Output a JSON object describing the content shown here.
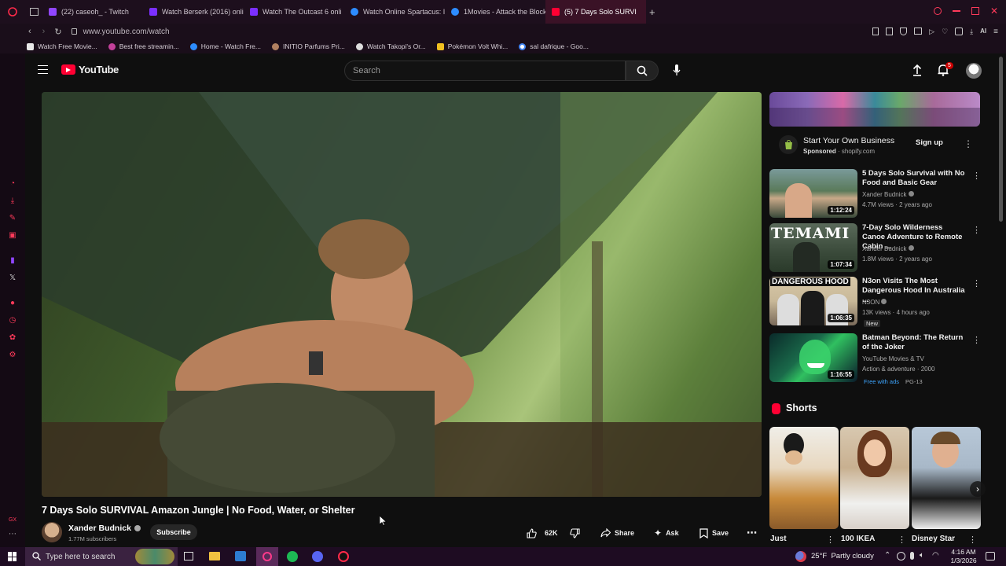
{
  "browser": {
    "tabs": [
      {
        "label": "(22) caseoh_ - Twitch",
        "color": "#9146ff"
      },
      {
        "label": "Watch Berserk (2016) onli",
        "color": "#7b2fff"
      },
      {
        "label": "Watch The Outcast 6 onli",
        "color": "#7b2fff"
      },
      {
        "label": "Watch Online Spartacus: I",
        "color": "#2d8cff"
      },
      {
        "label": "1Movies - Attack the Block",
        "color": "#2d8cff"
      },
      {
        "label": "(5) 7 Days Solo SURVI",
        "color": "#ff0033",
        "active": true
      }
    ],
    "new_tab": "+",
    "url": "www.youtube.com/watch",
    "bookmarks": [
      {
        "label": "Watch Free Movie...",
        "color": "#e8e8e8"
      },
      {
        "label": "Best free streamin...",
        "color": "#c3409a"
      },
      {
        "label": "Home - Watch Fre...",
        "color": "#2d8cff"
      },
      {
        "label": "INITIO Parfums Pri...",
        "color": "#b08060"
      },
      {
        "label": "Watch Takopi's Or...",
        "color": "#dddddd"
      },
      {
        "label": "Pokémon Volt Whi...",
        "color": "#f0c020"
      },
      {
        "label": "sal dafrique - Goo...",
        "color": "#ffffff"
      }
    ]
  },
  "youtube": {
    "logo": "YouTube",
    "search_placeholder": "Search",
    "notif_count": "5"
  },
  "video": {
    "title": "7 Days Solo SURVIVAL Amazon Jungle | No Food, Water, or Shelter",
    "channel": "Xander Budnick",
    "subscribers": "1.77M subscribers",
    "subscribe_label": "Subscribe",
    "likes": "62K",
    "share_label": "Share",
    "ask_label": "Ask",
    "save_label": "Save"
  },
  "ad": {
    "title": "Start Your Own Business",
    "sponsored": "Sponsored",
    "domain": "shopify.com",
    "cta": "Sign up"
  },
  "recommendations": [
    {
      "title": "5 Days Solo Survival with No Food and Basic Gear",
      "channel": "Xander Budnick",
      "meta": "4.7M views · 2 years ago",
      "duration": "1:12:24"
    },
    {
      "title": "7-Day Solo Wilderness Canoe Adventure to Remote Cabin ...",
      "channel": "Xander Budnick",
      "meta": "1.8M views · 2 years ago",
      "duration": "1:07:34",
      "thumb_text": "TEMAMI"
    },
    {
      "title": "N3on Visits The Most Dangerous Hood In Australia ...",
      "channel": "N3ON",
      "meta": "13K views · 4 hours ago",
      "badge": "New",
      "duration": "1:06:35",
      "thumb_text": "DANGEROUS HOOD"
    },
    {
      "title": "Batman Beyond: The Return of the Joker",
      "channel": "YouTube Movies & TV",
      "meta": "Action & adventure · 2000",
      "free": "Free with ads",
      "rating": "PG-13",
      "duration": "1:16:55"
    }
  ],
  "shorts": {
    "heading": "Shorts",
    "items": [
      {
        "title": "Just"
      },
      {
        "title": "100 IKEA"
      },
      {
        "title": "Disney Star"
      }
    ]
  },
  "taskbar": {
    "search_placeholder": "Type here to search",
    "weather": "25°F  Partly cloudy",
    "time": "4:16 AM",
    "date": "1/3/2026"
  }
}
